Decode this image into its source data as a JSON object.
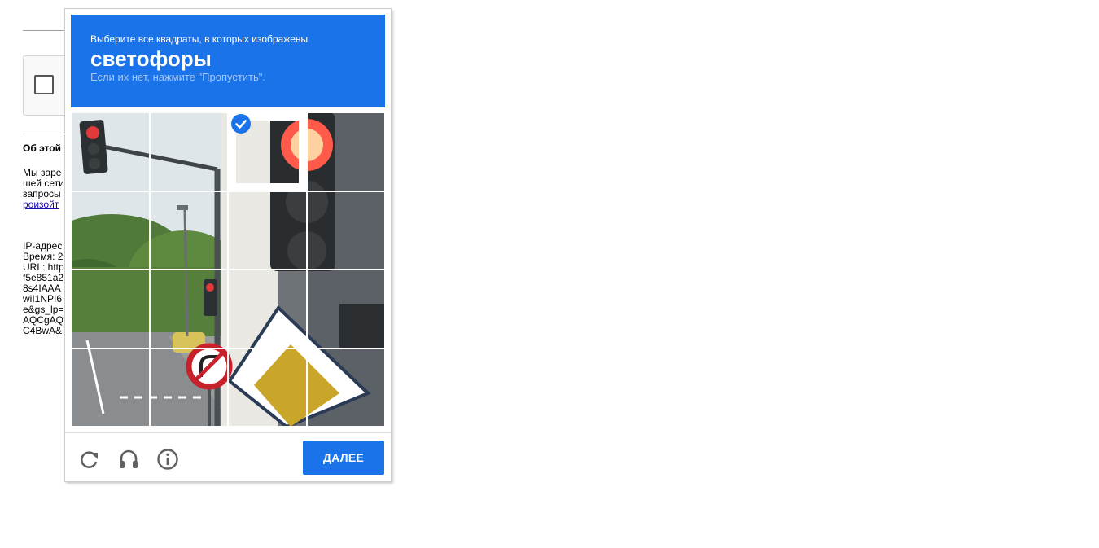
{
  "background_page": {
    "section_title": "Об этой",
    "paragraph_lines": [
      "Мы заре",
      "шей сети",
      "запросы"
    ],
    "link_text": "роизойт",
    "info_lines": [
      "IP-адрес",
      "Время: 2",
      "URL: http",
      "f5e851a2",
      "8s4IAAA",
      "wiI1NPI6",
      "e&gs_lp=",
      "AQCgAQ",
      "C4BwA&"
    ]
  },
  "challenge": {
    "instruction": "Выберите все квадраты, в которых изображены",
    "object": "светофоры",
    "hint": "Если их нет, нажмите \"Пропустить\".",
    "grid": {
      "rows": 4,
      "cols": 4,
      "selected_tiles": [
        2
      ]
    },
    "controls": {
      "reload_icon": "reload-icon",
      "audio_icon": "headphones-icon",
      "info_icon": "info-icon"
    },
    "next_button_label": "ДАЛЕЕ"
  },
  "colors": {
    "accent": "#1a73e8",
    "hint_text": "#a6c6f8"
  }
}
